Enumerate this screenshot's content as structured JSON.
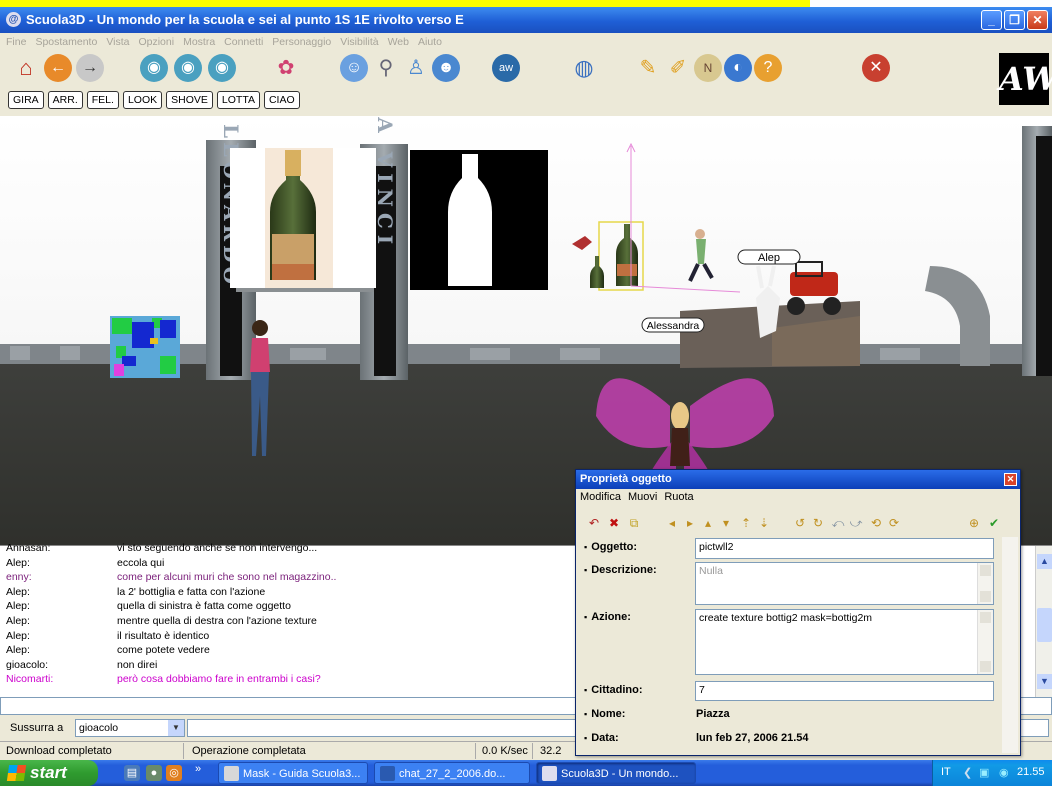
{
  "window": {
    "title": "Scuola3D - Un mondo per la scuola e sei al punto 1S 1E rivolto verso E"
  },
  "menubar": [
    "Fine",
    "Spostamento",
    "Vista",
    "Opzioni",
    "Mostra",
    "Connetti",
    "Personaggio",
    "Visibilità",
    "Web",
    "Aiuto"
  ],
  "toolbar": {
    "actions": [
      "GIRA",
      "ARR.",
      "FEL.",
      "LOOK",
      "SHOVE",
      "LOTTA",
      "CIAO"
    ],
    "logo": "AW"
  },
  "scene": {
    "sign_left": "LEONARDO",
    "sign_right": "DA VINCI",
    "avatar_labels": [
      "Alep",
      "Alessandra"
    ]
  },
  "chat": {
    "messages": [
      {
        "who": "Annasan:",
        "text": "vi sto seguendo anche se non intervengo...",
        "color": "#000000"
      },
      {
        "who": "Alep:",
        "text": "eccola qui",
        "color": "#000000"
      },
      {
        "who": "enny:",
        "text": "come per alcuni muri che sono nel magazzino..",
        "color": "#7a1f7a"
      },
      {
        "who": "Alep:",
        "text": "la 2' bottiglia e fatta con l'azione",
        "color": "#000000"
      },
      {
        "who": "Alep:",
        "text": "quella di sinistra è fatta come oggetto",
        "color": "#000000"
      },
      {
        "who": "Alep:",
        "text": "mentre quella di destra con l'azione texture",
        "color": "#000000"
      },
      {
        "who": "Alep:",
        "text": "il risultato è identico",
        "color": "#000000"
      },
      {
        "who": "Alep:",
        "text": "come potete vedere",
        "color": "#000000"
      },
      {
        "who": "gioacolo:",
        "text": "non direi",
        "color": "#000000"
      },
      {
        "who": "Nicomarti:",
        "text": "però cosa dobbiamo fare in entrambi i casi?",
        "color": "#cc00cc"
      }
    ]
  },
  "whisper": {
    "label": "Sussurra a",
    "target": "gioacolo"
  },
  "status": {
    "left": "Download completato",
    "middle": "Operazione completata",
    "speed": "0.0 K/sec",
    "fps": "32.2"
  },
  "dialog": {
    "title": "Proprietà oggetto",
    "menu": [
      "Modifica",
      "Muovi",
      "Ruota"
    ],
    "fields": {
      "oggetto_label": "Oggetto:",
      "oggetto": "pictwll2",
      "descrizione_label": "Descrizione:",
      "descrizione": "Nulla",
      "azione_label": "Azione:",
      "azione": "create texture bottig2 mask=bottig2m",
      "cittadino_label": "Cittadino:",
      "cittadino": "7",
      "nome_label": "Nome:",
      "nome": "Piazza",
      "data_label": "Data:",
      "data": "lun feb 27, 2006 21.54"
    }
  },
  "taskbar": {
    "start": "start",
    "tasks": [
      "Mask - Guida Scuola3...",
      "chat_27_2_2006.do...",
      "Scuola3D - Un mondo..."
    ],
    "lang": "IT",
    "clock": "21.55"
  }
}
